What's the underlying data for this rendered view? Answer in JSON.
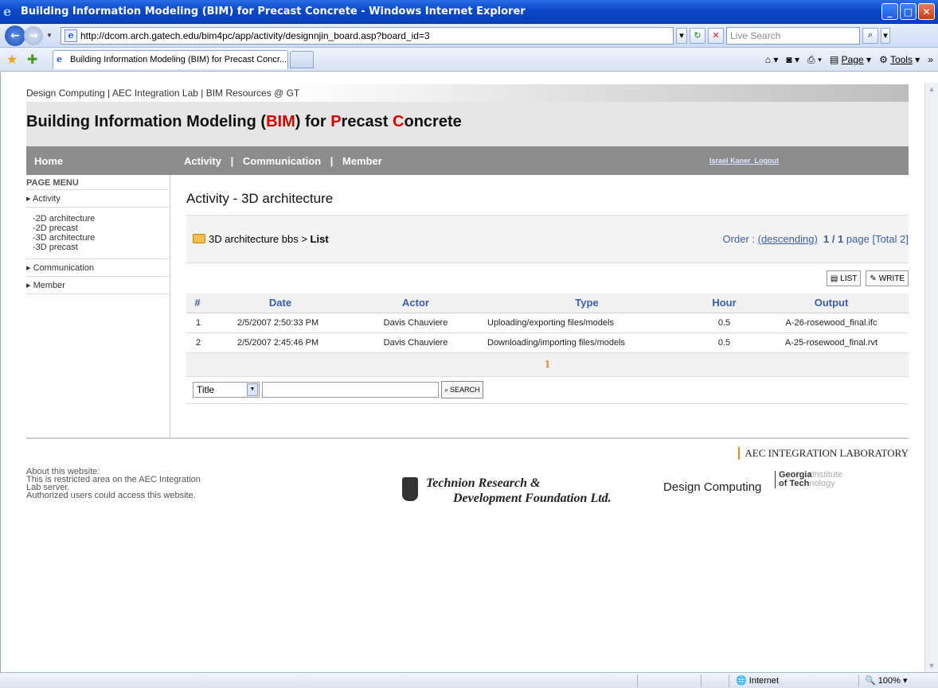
{
  "window": {
    "title": "Building Information Modeling (BIM) for Precast Concrete - Windows Internet Explorer",
    "url": "http://dcom.arch.gatech.edu/bim4pc/app/activity/designnjin_board.asp?board_id=3",
    "search_placeholder": "Live Search",
    "tab_title": "Building Information Modeling (BIM) for Precast Concr...",
    "tools": {
      "page": "Page",
      "tools": "Tools"
    },
    "status": {
      "zone": "Internet",
      "zoom": "100%"
    }
  },
  "site": {
    "top_links": "Design Computing | AEC Integration Lab | BIM Resources @ GT",
    "title_parts": [
      "Building Information Modeling (",
      "BIM",
      ") for ",
      "P",
      "recast ",
      "C",
      "oncrete"
    ],
    "nav": {
      "home": "Home",
      "activity": "Activity",
      "sep1": "|",
      "communication": "Communication",
      "sep2": "|",
      "member": "Member",
      "user": "Israel Kaner",
      "logout": "Logout"
    }
  },
  "sidebar": {
    "heading": "PAGE MENU",
    "activity": "Activity",
    "sub": [
      "-2D architecture",
      "-2D precast",
      "-3D architecture",
      "-3D precast"
    ],
    "communication": "Communication",
    "member": "Member"
  },
  "content": {
    "title": "Activity - 3D architecture",
    "breadcrumb": "3D architecture bbs > ",
    "breadcrumb_current": "List",
    "order_label": "Order : ",
    "order_value": "(descending)",
    "page_info": "1 / 1",
    "page_label": " page ",
    "total": "[Total 2]",
    "list_btn": "LIST",
    "write_btn": "WRITE",
    "columns": [
      "#",
      "Date",
      "Actor",
      "Type",
      "Hour",
      "Output"
    ],
    "rows": [
      {
        "num": "1",
        "date": "2/5/2007 2:50:33 PM",
        "actor": "Davis Chauviere",
        "type": "Uploading/exporting files/models",
        "hour": "0.5",
        "output": "A-26-rosewood_final.ifc"
      },
      {
        "num": "2",
        "date": "2/5/2007 2:45:46 PM",
        "actor": "Davis Chauviere",
        "type": "Downloading/importing files/models",
        "hour": "0.5",
        "output": "A-25-rosewood_final.rvt"
      }
    ],
    "pager": "1",
    "search_field": "Title",
    "search_btn": "SEARCH"
  },
  "footer": {
    "about": [
      "About this website:",
      "This is restricted area on the AEC Integration",
      "Lab server.",
      "Authorized users could access this website."
    ],
    "aec": "AEC INTEGRATION LABORATORY",
    "technion1": "Technion Research &",
    "technion2": "Development Foundation Ltd.",
    "dc": "Design Computing",
    "gt1": "Georgia",
    "gt2": "Institute",
    "gt3": "of Tech",
    "gt4": "nology"
  }
}
